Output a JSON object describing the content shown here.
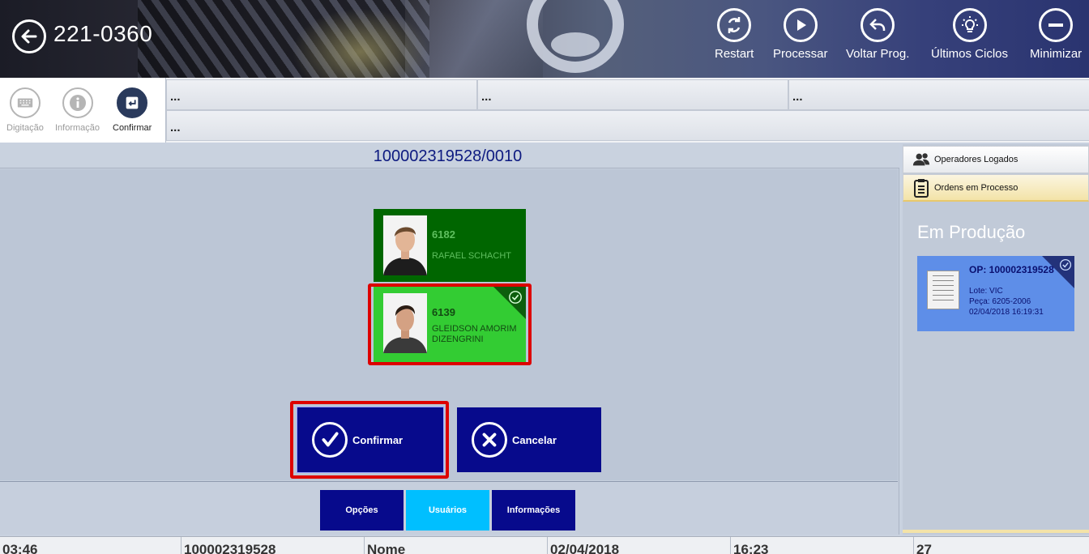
{
  "header": {
    "title": "221-0360",
    "actions": [
      {
        "label": "Restart",
        "icon": "restart-icon"
      },
      {
        "label": "Processar",
        "icon": "play-icon"
      },
      {
        "label": "Voltar Prog.",
        "icon": "undo-icon"
      },
      {
        "label": "Últimos Ciclos",
        "icon": "lightbulb-icon"
      },
      {
        "label": "Minimizar",
        "icon": "minimize-icon"
      }
    ]
  },
  "toolbar": {
    "items": [
      {
        "label": "Digitação",
        "icon": "keyboard-icon",
        "enabled": false
      },
      {
        "label": "Informação",
        "icon": "info-icon",
        "enabled": false
      },
      {
        "label": "Confirmar",
        "icon": "enter-icon",
        "enabled": true
      }
    ]
  },
  "info_grid": [
    "...",
    "...",
    "...",
    "..."
  ],
  "order_number": "100002319528/0010",
  "operators": [
    {
      "id": "6182",
      "name": "RAFAEL SCHACHT",
      "selected": false
    },
    {
      "id": "6139",
      "name": "GLEIDSON AMORIM DIZENGRINI",
      "selected": true
    }
  ],
  "actions": {
    "confirm_label": "Confirmar",
    "cancel_label": "Cancelar"
  },
  "footer_tabs": [
    {
      "label": "Opções",
      "active": false
    },
    {
      "label": "Usuários",
      "active": true
    },
    {
      "label": "Informações",
      "active": false
    }
  ],
  "right_panel": {
    "tabs": [
      {
        "label": "Operadores Logados",
        "icon": "users-icon"
      },
      {
        "label": "Ordens em Processo",
        "icon": "clipboard-icon"
      }
    ],
    "section_title": "Em Produção",
    "order": {
      "op": "OP: 100002319528",
      "lote": "Lote: VIC",
      "peca": "Peça: 6205-2006",
      "datetime": "02/04/2018 16:19:31"
    }
  },
  "status_bar": [
    "03:46",
    "100002319528",
    "Nome",
    "02/04/2018",
    "16:23",
    "27"
  ],
  "colors": {
    "navy_button": "#070a8c",
    "active_tab": "#00bfff",
    "operator_selected": "#33cc33",
    "operator_default": "#006600",
    "selection_outline": "#dd0000",
    "order_card": "#5e8ee8"
  }
}
